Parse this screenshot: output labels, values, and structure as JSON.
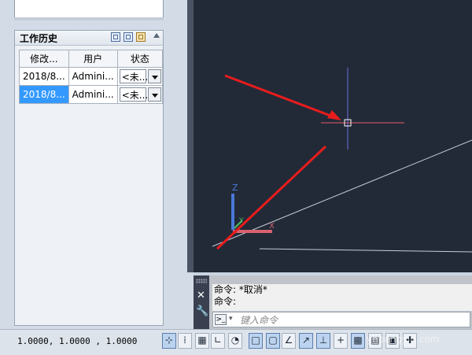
{
  "work_history": {
    "title": "工作历史",
    "columns": [
      "修改...",
      "用户",
      "状态"
    ],
    "rows": [
      {
        "modified": "2018/8...",
        "user": "Admini...",
        "status": "<未..."
      },
      {
        "modified": "2018/8...",
        "user": "Admini...",
        "status": "<未..."
      }
    ],
    "selected_row": 1
  },
  "command_line": {
    "history": [
      "命令:  *取消*",
      "命令:"
    ],
    "placeholder": "键入命令"
  },
  "status_bar": {
    "coordinates": "1.0000,  1.0000 , 1.0000",
    "buttons": [
      "snap-mode",
      "grid-display",
      "ortho-mode",
      "polar-tracking",
      "object-snap",
      "3d-object-snap",
      "object-snap-tracking",
      "dynamic-ucs",
      "dynamic-input",
      "lineweight",
      "transparency",
      "quick-properties",
      "selection-cycling",
      "annotation-monitor"
    ]
  },
  "watermark": "ynpengyin.com",
  "colors": {
    "canvas_bg": "#222a38",
    "selection": "#3399ff",
    "annotation_arrow": "#e81c1c",
    "crosshair_x": "#e85a6a",
    "crosshair_y": "#6c6fe0"
  }
}
